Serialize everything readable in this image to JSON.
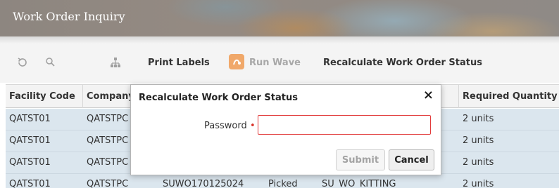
{
  "header": {
    "title": "Work Order Inquiry"
  },
  "toolbar": {
    "refresh_icon": "refresh-icon",
    "search_icon": "search-icon",
    "hierarchy_icon": "hierarchy-icon",
    "print_labels": "Print Labels",
    "run_wave": "Run Wave",
    "recalculate": "Recalculate Work Order Status"
  },
  "table": {
    "columns": [
      "Facility Code",
      "Company",
      "",
      "",
      "",
      "Required Quantity"
    ],
    "rows": [
      [
        "QATST01",
        "QATSTPC",
        "",
        "",
        "",
        "2 units"
      ],
      [
        "QATST01",
        "QATSTPC",
        "",
        "",
        "",
        "2 units"
      ],
      [
        "QATST01",
        "QATSTPC",
        "",
        "",
        "",
        "2 units"
      ],
      [
        "QATST01",
        "QATSTPC",
        "SUWO170125024",
        "Picked",
        "SU_WO_KITTING",
        "2 units"
      ]
    ]
  },
  "modal": {
    "title": "Recalculate Work Order Status",
    "close": "×",
    "password_label": "Password",
    "required_marker": "•",
    "password_value": "",
    "submit": "Submit",
    "cancel": "Cancel"
  },
  "colors": {
    "row_bg": "#dbe6ee",
    "error_border": "#e23b3b",
    "wave_icon_bg": "#f0a86a"
  }
}
